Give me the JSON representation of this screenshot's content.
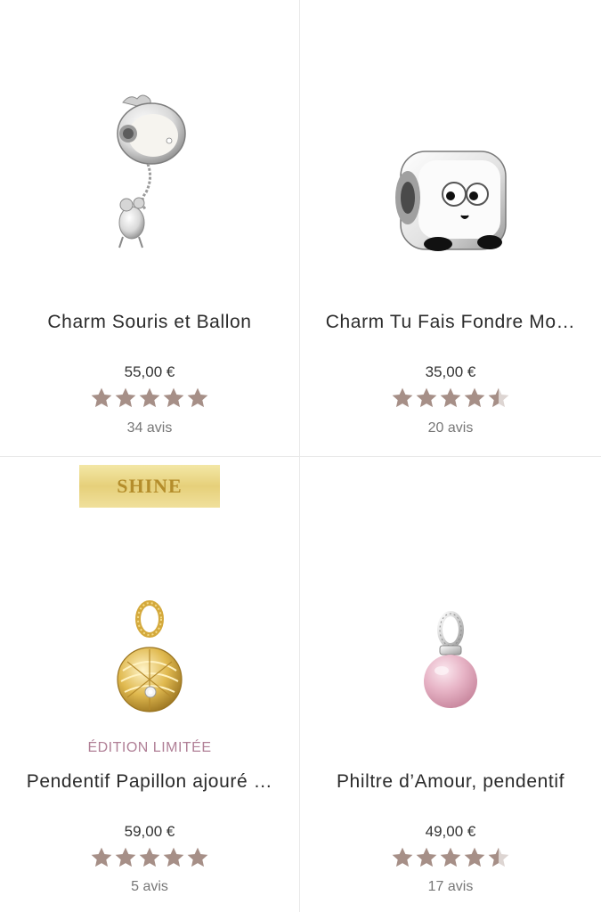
{
  "products": [
    {
      "name": "Charm Souris et Ballon",
      "price": "55,00 €",
      "rating": 5,
      "reviews": "34 avis",
      "image": "mouse-balloon-charm-icon"
    },
    {
      "name": "Charm Tu Fais Fondre Mo…",
      "price": "35,00 €",
      "rating": 4.5,
      "reviews": "20 avis",
      "image": "cube-face-charm-icon"
    },
    {
      "badge": "SHINE",
      "edition": "ÉDITION LIMITÉE",
      "name": "Pendentif Papillon ajouré …",
      "price": "59,00 €",
      "rating": 5,
      "reviews": "5 avis",
      "image": "butterfly-pendant-icon"
    },
    {
      "name": "Philtre d’Amour, pendentif",
      "price": "49,00 €",
      "rating": 4.5,
      "reviews": "17 avis",
      "image": "pink-potion-pendant-icon"
    }
  ],
  "colors": {
    "star": "#a68f87",
    "star_empty": "#ddd5d2",
    "edition": "#b07f96",
    "badge_text": "#b48d2b"
  }
}
